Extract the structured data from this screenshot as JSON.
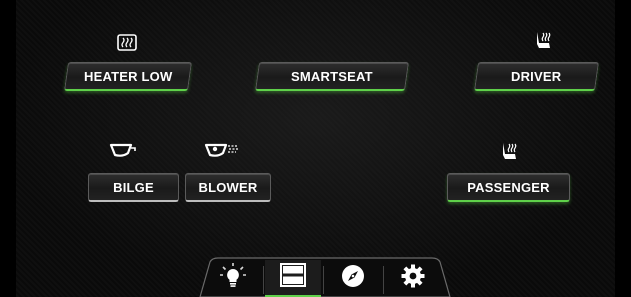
{
  "colors": {
    "accent_on": "#5fd14a",
    "accent_off": "#bdbdbd",
    "text": "#ffffff",
    "background": "#0a0a0a"
  },
  "controls": {
    "heater": {
      "label": "HEATER LOW",
      "icon": "heater-icon",
      "state": "on"
    },
    "smartseat": {
      "label": "SMARTSEAT",
      "state": "on"
    },
    "driver": {
      "label": "DRIVER",
      "icon": "seat-heat-icon",
      "state": "on"
    },
    "bilge": {
      "label": "BILGE",
      "icon": "bilge-icon",
      "state": "off"
    },
    "blower": {
      "label": "BLOWER",
      "icon": "blower-icon",
      "state": "off"
    },
    "passenger": {
      "label": "PASSENGER",
      "icon": "seat-heat-icon",
      "state": "on"
    }
  },
  "nav": {
    "items": [
      {
        "name": "lights",
        "icon": "lightbulb-icon",
        "active": false
      },
      {
        "name": "switches",
        "icon": "switch-panel-icon",
        "active": true
      },
      {
        "name": "navigation",
        "icon": "compass-icon",
        "active": false
      },
      {
        "name": "settings",
        "icon": "gear-icon",
        "active": false
      }
    ]
  }
}
